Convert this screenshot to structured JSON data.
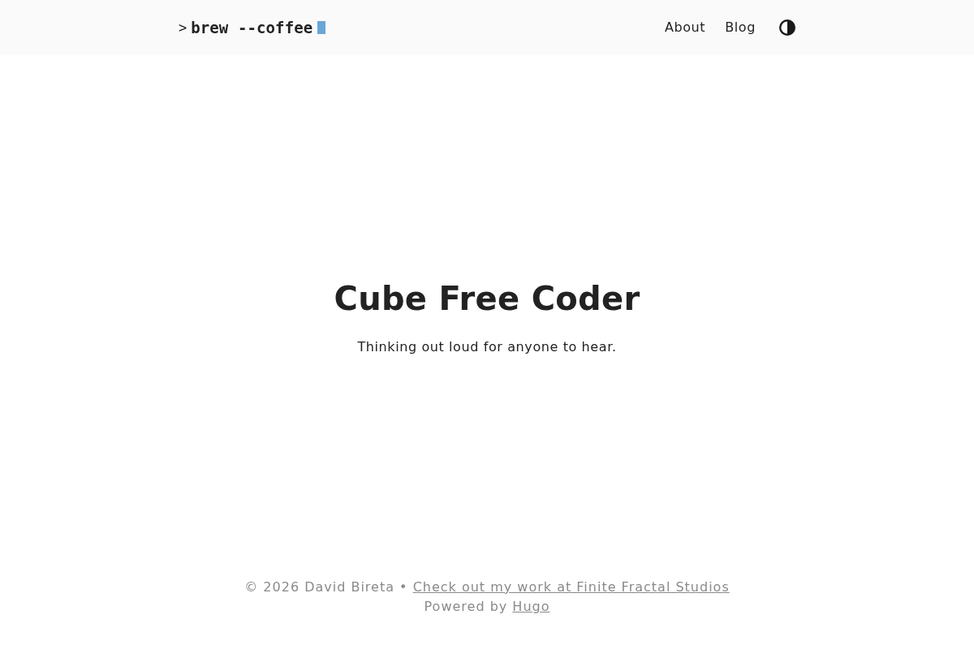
{
  "header": {
    "logo": {
      "prompt": ">",
      "command": "brew --coffee"
    },
    "nav": [
      {
        "label": "About"
      },
      {
        "label": "Blog"
      }
    ]
  },
  "hero": {
    "title": "Cube Free Coder",
    "tagline": "Thinking out loud for anyone to hear."
  },
  "footer": {
    "lines": [
      {
        "text": "© 2026 David Bireta • ",
        "link": "Check out my work at Finite Fractal Studios"
      },
      {
        "text": "Powered by ",
        "link": "Hugo"
      }
    ]
  }
}
